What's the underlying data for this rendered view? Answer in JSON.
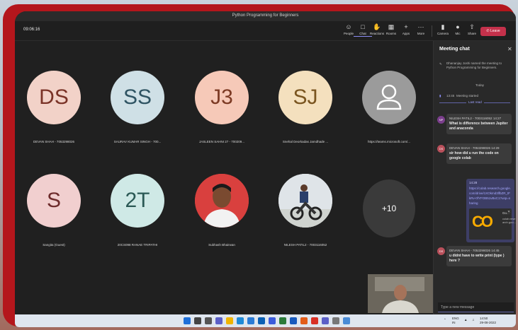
{
  "window": {
    "title": "Python Programming for Beginners"
  },
  "toolbar": {
    "timer": "09:06:16",
    "buttons": [
      {
        "label": "People",
        "icon": "people-icon"
      },
      {
        "label": "Chat",
        "icon": "chat-icon"
      },
      {
        "label": "Reactions",
        "icon": "reactions-icon"
      },
      {
        "label": "Rooms",
        "icon": "rooms-icon"
      },
      {
        "label": "Apps",
        "icon": "apps-icon"
      },
      {
        "label": "More",
        "icon": "more-icon"
      },
      {
        "label": "Camera",
        "icon": "camera-icon"
      },
      {
        "label": "Mic",
        "icon": "mic-icon"
      },
      {
        "label": "Share",
        "icon": "share-icon"
      }
    ],
    "leave_label": "Leave"
  },
  "participants": [
    {
      "initials": "DS",
      "name": "DEVAN SHAH - 7053298026",
      "bg": "#f2d2c8",
      "fg": "#7a3327"
    },
    {
      "initials": "SS",
      "name": "SAURAV KUMAR SINGH - 700...",
      "bg": "#cfe0e6",
      "fg": "#2f5463"
    },
    {
      "initials": "J3",
      "name": "JASLEEN SAHNI 27 - 700209...",
      "bg": "#f6c9b8",
      "fg": "#7c3a24"
    },
    {
      "initials": "SJ",
      "name": "Snehal Deorkadas Jamdhade ...",
      "bg": "#f4e0be",
      "fg": "#7a5520"
    },
    {
      "initials": "",
      "name": "https://teams.microsoft.com/...",
      "bg": "#9b9b9b",
      "fg": "#ffffff"
    },
    {
      "initials": "S",
      "name": "Sangita (Guest)",
      "bg": "#f1cfcf",
      "fg": "#6e2c2c"
    },
    {
      "initials": "2T",
      "name": "20CS098 RANAE TRIPATHI",
      "bg": "#cfe9e6",
      "fg": "#2b5955"
    },
    {
      "initials": "",
      "name": "Subhash Bhairwan",
      "bg": "#d9403e",
      "fg": "#ffffff"
    },
    {
      "initials": "",
      "name": "NILESH PATIL2 - 7003116052",
      "bg": "#e8e8e8",
      "fg": "#ffffff"
    }
  ],
  "more_count": "+10",
  "chat": {
    "title": "Meeting chat",
    "system_msg": "Dhananjay Joshi named the meeting to Python Programming for Beginners.",
    "day": "Today",
    "started_time": "13:45",
    "started_text": "Meeting started",
    "last_read": "Last read",
    "messages": [
      {
        "avatar": "NP",
        "avatar_bg": "#7b3e8c",
        "author": "NILESH PATIL2 - 7003116052",
        "time": "14:27",
        "text": "What is difference between Jupiter and anaconda"
      },
      {
        "avatar": "DS",
        "avatar_bg": "#b9505b",
        "author": "DEVAN SHAH - 7053298026",
        "time": "14:29",
        "text": "sir how did u run the code on google colab"
      },
      {
        "avatar": "DS",
        "avatar_bg": "#b9505b",
        "author": "DEVAN SHAH - 7053298026",
        "time": "14:45",
        "text": "u didnt have to write print (type ) here ?"
      }
    ],
    "mine_time": "14:28",
    "mine_link": "https://colab.research.google.com/drive/1XOkmd3lfbZR_tFkRv-0fYFOB51vBxC1?usp=sharing",
    "card_title": "Go...",
    "card_sub": "colab.rese arch.goo...",
    "card_logo": "CO",
    "compose_placeholder": "Type a new message"
  },
  "taskbar": {
    "lang": "ENG",
    "region": "IN",
    "time": "14:50",
    "date": "29-08-2022"
  }
}
